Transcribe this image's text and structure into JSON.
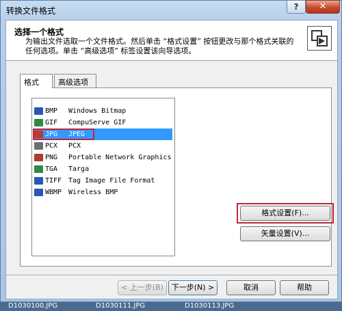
{
  "window": {
    "title": "转换文件格式",
    "help_glyph": "?",
    "close_glyph": "✕"
  },
  "header": {
    "title": "选择一个格式",
    "description": "为输出文件选取一个文件格式。然后单击 “格式设置” 按钮更改与那个格式关联的任何选项。单击 “高级选项” 标签设置该向导选项。",
    "icon": "convert-format-icon"
  },
  "tabs": [
    {
      "label": "格式",
      "active": true
    },
    {
      "label": "高级选项",
      "active": false
    }
  ],
  "formats": [
    {
      "ext": "BMP",
      "desc": "Windows Bitmap",
      "icon_color": "#2a57b4"
    },
    {
      "ext": "GIF",
      "desc": "CompuServe GIF",
      "icon_color": "#2f8a46"
    },
    {
      "ext": "JPG",
      "desc": "JPEG",
      "icon_color": "#c0392b",
      "selected": true
    },
    {
      "ext": "PCX",
      "desc": "PCX",
      "icon_color": "#6d6d6d"
    },
    {
      "ext": "PNG",
      "desc": "Portable Network Graphics",
      "icon_color": "#b03a2e"
    },
    {
      "ext": "TGA",
      "desc": "Targa",
      "icon_color": "#2f8a46"
    },
    {
      "ext": "TIFF",
      "desc": "Tag Image File Format",
      "icon_color": "#2a57b4"
    },
    {
      "ext": "WBMP",
      "desc": "Wireless BMP",
      "icon_color": "#2a57b4"
    }
  ],
  "buttons": {
    "format_settings": "格式设置(F)...",
    "vector_settings": "矢量设置(V)...",
    "back": "< 上一步(B)",
    "next": "下一步(N) >",
    "cancel": "取消",
    "help": "帮助"
  },
  "taskbar": [
    "D1030100.JPG",
    "D1030111.JPG",
    "D1030113.JPG"
  ],
  "colors": {
    "selection": "#3399ff",
    "highlight_box": "#c0243c"
  }
}
